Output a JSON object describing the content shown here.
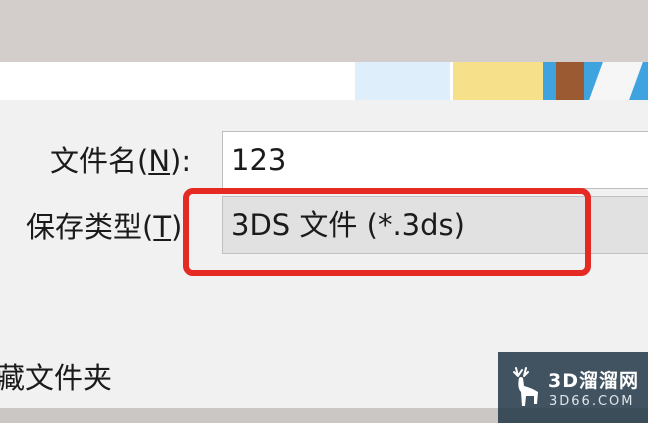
{
  "save_dialog": {
    "filename_label": "文件名(",
    "filename_label_hotkey": "N",
    "filename_label_suffix": "):",
    "filename_value": "123",
    "filetype_label": "保存类型(",
    "filetype_label_hotkey": "T",
    "filetype_label_suffix": "):",
    "filetype_value": "3DS 文件 (*.3ds)",
    "hide_folders_label": "藏文件夹"
  },
  "annotation": {
    "highlight_color": "#e42a22"
  },
  "watermark": {
    "name": "3D溜溜网",
    "domain": "3D66.COM"
  }
}
